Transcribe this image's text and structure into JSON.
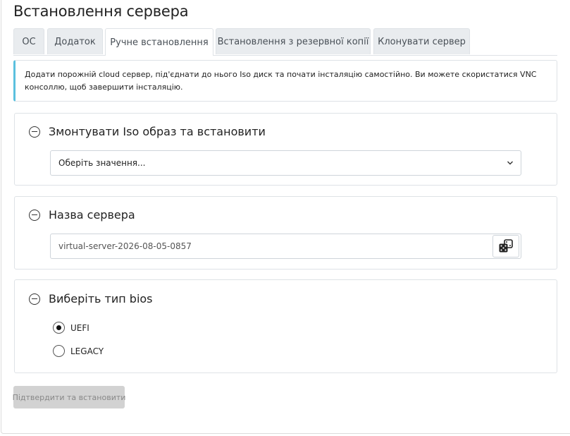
{
  "page": {
    "title": "Встановлення сервера"
  },
  "tabs": [
    {
      "label": "ОС",
      "active": false
    },
    {
      "label": "Додаток",
      "active": false
    },
    {
      "label": "Ручне встановлення",
      "active": true
    },
    {
      "label": "Встановлення з резервної копії",
      "active": false
    },
    {
      "label": "Клонувати сервер",
      "active": false
    }
  ],
  "info_alert": {
    "text": "Додати порожній cloud сервер, під'єднати до нього Iso диск та почати інсталяцію самостійно. Ви можете скористатися VNC консоллю, щоб завершити інсталяцію.",
    "accent_color": "#5bc0de"
  },
  "iso_section": {
    "title": "Змонтувати Iso образ та встановити",
    "select_value": "Оберіть значення..."
  },
  "name_section": {
    "title": "Назва сервера",
    "input_value": "virtual-server-2026-08-05-0857",
    "random_button_icon": "dice-icon"
  },
  "bios_section": {
    "title": "Виберіть тип bios",
    "options": [
      {
        "label": "UEFI",
        "checked": true
      },
      {
        "label": "LEGACY",
        "checked": false
      }
    ]
  },
  "actions": {
    "submit_label": "Підтвердити та встановити",
    "submit_disabled": true
  }
}
